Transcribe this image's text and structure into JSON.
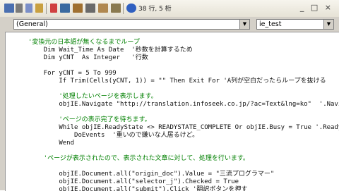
{
  "status": {
    "position_text": "38 行, 5 桁"
  },
  "toolbar": {
    "icons": [
      "save-icon",
      "cut-icon",
      "copy-icon",
      "paste-icon",
      "find-icon",
      "undo-icon",
      "redo-icon",
      "run-icon",
      "pause-icon",
      "stop-icon",
      "design-icon",
      "project-icon",
      "properties-icon",
      "object-browser-icon",
      "toolbox-icon",
      "help-icon"
    ]
  },
  "window_buttons": "_ □ ×",
  "dropdowns": {
    "object": "(General)",
    "procedure": "ie_test"
  },
  "colors": {
    "comment": "#008000",
    "keyword": "#00008b",
    "text": "#111111"
  },
  "code_lines": [
    "'変換元の日本語が無くなるまでループ",
    "    Dim Wait_Time As Date  '秒数を計算するため",
    "    Dim yCNT  As Integer   '行数",
    "",
    "    For yCNT = 5 To 999",
    "        If Trim(Cells(yCNT, 1)) = \"\" Then Exit For 'A列が空白だったらループを抜ける",
    "",
    "        '処理したいページを表示します。",
    "        objIE.Navigate \"http://translation.infoseek.co.jp/?ac=Text&lng=ko\"  '.Naviga",
    "",
    "        'ページの表示完了を待ちます。",
    "        While objIE.ReadyState <> READYSTATE_COMPLETE Or objIE.Busy = True '.ReadyS",
    "            DoEvents  '重いので嫌いな人居るけど。",
    "        Wend",
    "",
    "    'ページが表示されたので、表示された文章に対して、処理を行います。",
    "",
    "        objIE.Document.all(\"origin_doc\").Value = \"三流プログラマー\"",
    "        objIE.Document.all(\"selector_j\").Checked = True",
    "        objIE.Document.all(\"submit\").Click '翻訳ボタンを押す"
  ]
}
